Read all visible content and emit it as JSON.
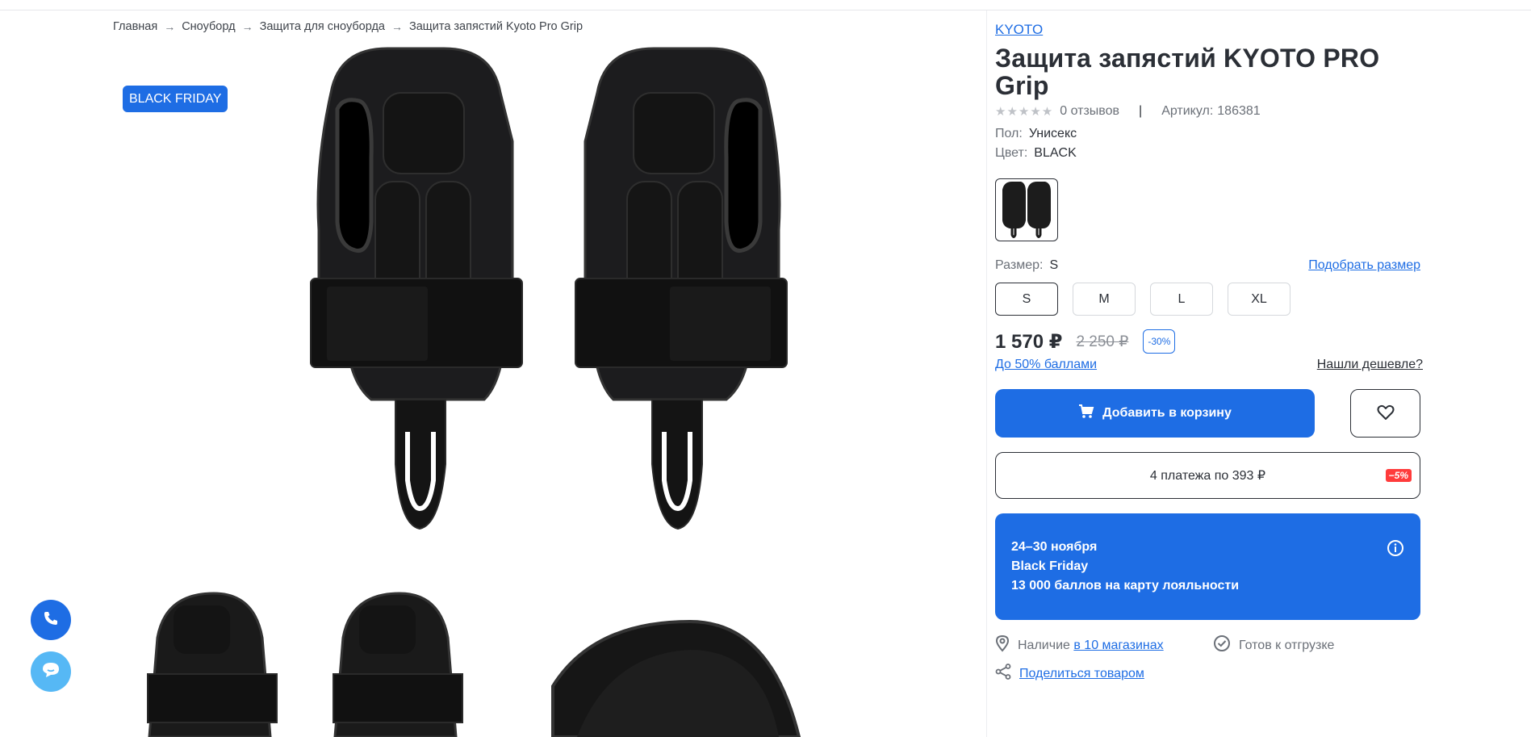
{
  "breadcrumb": {
    "items": [
      "Главная",
      "Сноуборд",
      "Защита для сноуборда",
      "Защита запястий Kyoto Pro Grip"
    ],
    "separator": "→"
  },
  "gallery": {
    "badge": "BLACK FRIDAY"
  },
  "product": {
    "brand": "KYOTO",
    "title": "Защита запястий KYOTO PRO Grip",
    "rating_stars": "★★★★★",
    "reviews": "0 отзывов",
    "article_label": "Артикул:",
    "article": "186381",
    "gender_label": "Пол:",
    "gender": "Унисекс",
    "color_label": "Цвет:",
    "color": "BLACK",
    "size_label": "Размер:",
    "size_selected": "S",
    "size_guide": "Подобрать размер",
    "sizes": [
      "S",
      "M",
      "L",
      "XL"
    ],
    "price": "1 570 ₽",
    "old_price": "2 250 ₽",
    "discount": "-30%",
    "bonus": "До 50% баллами",
    "cheaper": "Нашли дешевле?",
    "add_to_cart": "Добавить в корзину",
    "installments": "4 платежа по 393 ₽",
    "installments_badge": "−5%",
    "promo": {
      "dates": "24–30 ноября",
      "name": "Black Friday",
      "text": "13 000 баллов на карту лояльности"
    },
    "availability_prefix": "Наличие",
    "availability_link": "в 10 магазинах",
    "ready": "Готов к отгрузке",
    "share": "Поделиться товаром"
  },
  "colors": {
    "accent": "#1e6de4",
    "chat": "#56b8f5",
    "sale_badge": "#ff3b3b",
    "text": "#2b2f36"
  }
}
